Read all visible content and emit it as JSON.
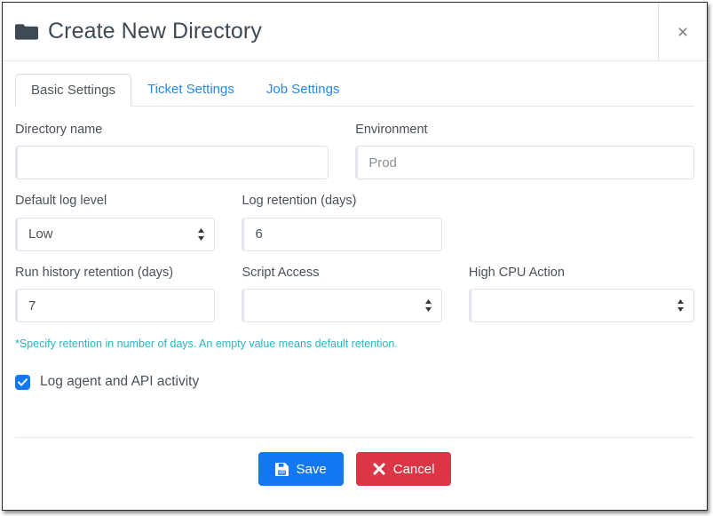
{
  "window": {
    "title": "Create New Directory",
    "title_icon": "folder-icon",
    "close_icon": "close-icon",
    "close_label": "×"
  },
  "tabs": [
    {
      "label": "Basic Settings",
      "active": true
    },
    {
      "label": "Ticket Settings",
      "active": false
    },
    {
      "label": "Job Settings",
      "active": false
    }
  ],
  "form": {
    "directory_name": {
      "label": "Directory name",
      "value": "",
      "placeholder": ""
    },
    "environment": {
      "label": "Environment",
      "value": "",
      "placeholder": "Prod"
    },
    "default_log_level": {
      "label": "Default log level",
      "value": "Low",
      "options": [
        "Low"
      ]
    },
    "log_retention_days": {
      "label": "Log retention (days)",
      "value": "6",
      "placeholder": ""
    },
    "run_history_retention_days": {
      "label": "Run history retention (days)",
      "value": "7",
      "placeholder": ""
    },
    "script_access": {
      "label": "Script Access",
      "value": "",
      "options": [
        ""
      ]
    },
    "high_cpu_action": {
      "label": "High CPU Action",
      "value": "",
      "options": [
        ""
      ]
    },
    "hint": "*Specify retention in number of days. An empty value means default retention.",
    "log_agent_checkbox": {
      "label": "Log agent and API activity",
      "checked": true
    }
  },
  "footer": {
    "save_label": "Save",
    "save_icon": "save-disk-icon",
    "cancel_label": "Cancel",
    "cancel_icon": "close-x-icon"
  },
  "colors": {
    "accent_blue": "#1277f2",
    "link_blue": "#2689f2",
    "danger_red": "#dc3545",
    "hint_teal": "#2cb4c4",
    "title_slate": "#3f4a54"
  }
}
